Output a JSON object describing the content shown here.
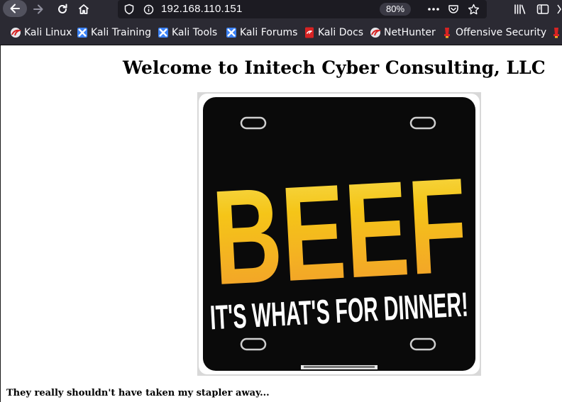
{
  "browser": {
    "url": "192.168.110.151",
    "zoom": "80%"
  },
  "bookmarks": [
    {
      "label": "Kali Linux",
      "icon": "kali-dragon-icon"
    },
    {
      "label": "Kali Training",
      "icon": "kali-training-icon"
    },
    {
      "label": "Kali Tools",
      "icon": "kali-tools-icon"
    },
    {
      "label": "Kali Forums",
      "icon": "kali-forums-icon"
    },
    {
      "label": "Kali Docs",
      "icon": "kali-docs-icon"
    },
    {
      "label": "NetHunter",
      "icon": "kali-dragon-icon"
    },
    {
      "label": "Offensive Security",
      "icon": "offsec-icon"
    }
  ],
  "page": {
    "heading": "Welcome to Initech Cyber Consulting, LLC",
    "plate_big_text": "BEEF",
    "plate_tagline": "IT'S WHAT'S FOR DINNER!",
    "caption": "They really shouldn't have taken my stapler away..."
  },
  "colors": {
    "chrome_bg": "#2b2a33",
    "urlbar_bg": "#1c1b22",
    "plate_yellow": "#f5c518",
    "plate_orange": "#f29a2e",
    "kali_red": "#d72323",
    "kali_blue": "#3b82f6"
  }
}
